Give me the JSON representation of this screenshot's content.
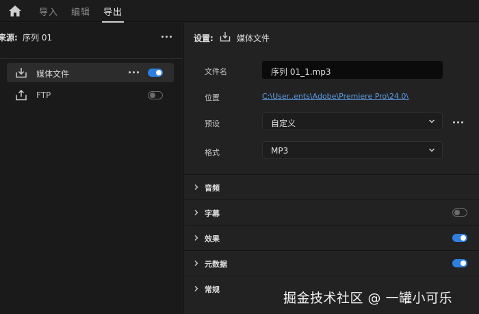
{
  "nav": {
    "tabs": [
      {
        "label": "导入",
        "active": false
      },
      {
        "label": "编辑",
        "active": false
      },
      {
        "label": "导出",
        "active": true
      }
    ]
  },
  "source": {
    "label": "来源:",
    "value": "序列 01"
  },
  "destinations": [
    {
      "label": "媒体文件",
      "icon": "download-icon",
      "enabled": true,
      "selected": true
    },
    {
      "label": "FTP",
      "icon": "upload-icon",
      "enabled": false,
      "selected": false
    }
  ],
  "settings": {
    "title": "设置:",
    "subtitle": "媒体文件",
    "filename": {
      "label": "文件名",
      "value": "序列 01_1.mp3"
    },
    "location": {
      "label": "位置",
      "value": "C:\\User..ents\\Adobe\\Premiere Pro\\24.0\\"
    },
    "preset": {
      "label": "预设",
      "value": "自定义"
    },
    "format": {
      "label": "格式",
      "value": "MP3"
    }
  },
  "sections": [
    {
      "label": "音频",
      "toggle": null
    },
    {
      "label": "字幕",
      "toggle": false
    },
    {
      "label": "效果",
      "toggle": true
    },
    {
      "label": "元数据",
      "toggle": true
    },
    {
      "label": "常规",
      "toggle": null
    }
  ],
  "watermark": "掘金技术社区 @ 一罐小可乐",
  "colors": {
    "accent": "#2f7fe0",
    "link": "#5c9ee8"
  }
}
